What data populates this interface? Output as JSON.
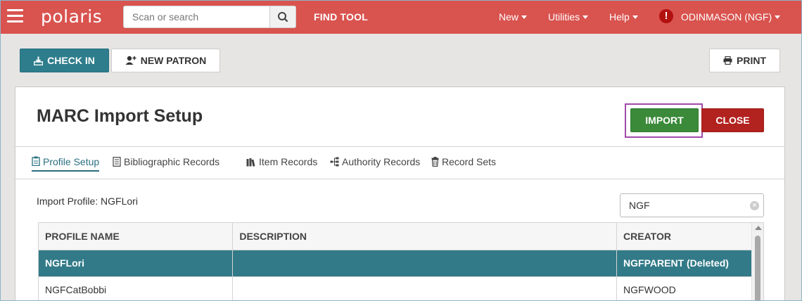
{
  "navbar": {
    "logo": "polaris",
    "search_placeholder": "Scan or search",
    "find_tool": "FIND TOOL",
    "menus": [
      "New",
      "Utilities",
      "Help"
    ],
    "alert_glyph": "!",
    "user": "ODINMASON (NGF)"
  },
  "toolbar": {
    "check_in": "CHECK IN",
    "new_patron": "NEW PATRON",
    "print": "PRINT"
  },
  "panel": {
    "title": "MARC Import Setup",
    "import": "IMPORT",
    "close": "CLOSE",
    "tabs": [
      "Profile Setup",
      "Bibliographic Records",
      "Item Records",
      "Authority Records",
      "Record Sets"
    ],
    "import_profile_label": "Import Profile: NGFLori",
    "filter_value": "NGF"
  },
  "table": {
    "headers": [
      "PROFILE NAME",
      "DESCRIPTION",
      "CREATOR"
    ],
    "rows": [
      {
        "name": "NGFLori",
        "description": "",
        "creator": "NGFPARENT (Deleted)",
        "selected": true
      },
      {
        "name": "NGFCatBobbi",
        "description": "",
        "creator": "NGFWOOD",
        "selected": false
      }
    ]
  },
  "colors": {
    "navbar": "#d9534f",
    "primary_teal": "#2e7d8c",
    "import_green": "#3a8a3a",
    "close_red": "#b2221f",
    "highlight_purple": "#a04aa8"
  }
}
